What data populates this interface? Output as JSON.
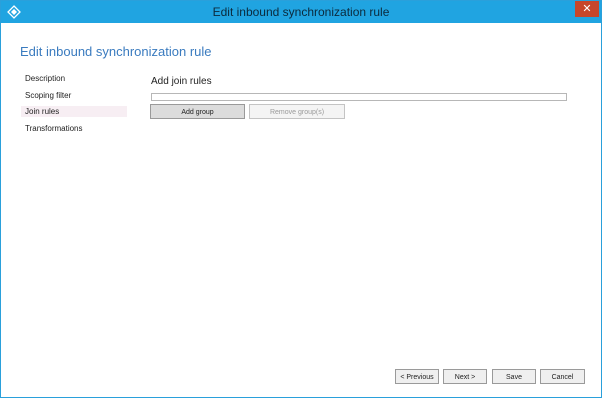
{
  "window": {
    "title": "Edit inbound synchronization rule",
    "close_glyph": "✕"
  },
  "page": {
    "heading": "Edit inbound synchronization rule"
  },
  "nav": {
    "items": [
      {
        "label": "Description",
        "active": false
      },
      {
        "label": "Scoping filter",
        "active": false
      },
      {
        "label": "Join rules",
        "active": true
      },
      {
        "label": "Transformations",
        "active": false
      }
    ]
  },
  "join_rules": {
    "title": "Add join rules",
    "add_group_label": "Add group",
    "remove_groups_label": "Remove group(s)"
  },
  "footer": {
    "previous_label": "< Previous",
    "next_label": "Next >",
    "save_label": "Save",
    "cancel_label": "Cancel"
  },
  "colors": {
    "titlebar": "#20a4e1",
    "heading": "#3a7bbf",
    "close": "#c7462a"
  },
  "icons": {
    "app": "app-diamond-icon",
    "close": "close-icon"
  }
}
